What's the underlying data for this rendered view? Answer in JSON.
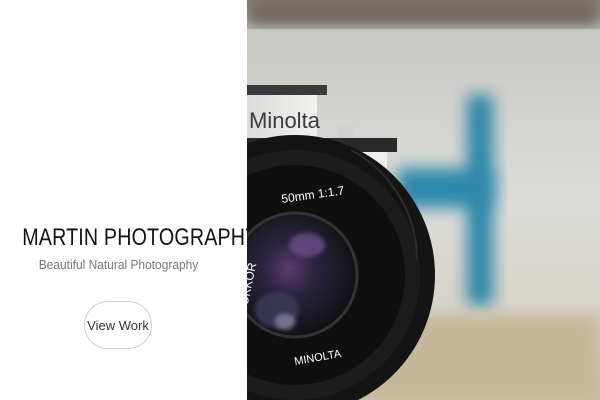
{
  "site": {
    "title": "MARTIN PHOTOGRAPHY",
    "tagline": "Beautiful Natural Photography",
    "cta_label": "View Work"
  },
  "hero": {
    "camera_brand": "Minolta",
    "lens_text_1": "50mm 1:1.7",
    "lens_text_2": "MD ROKKOR",
    "lens_text_3": "MINOLTA",
    "accent_color": "#1e7ea1"
  }
}
